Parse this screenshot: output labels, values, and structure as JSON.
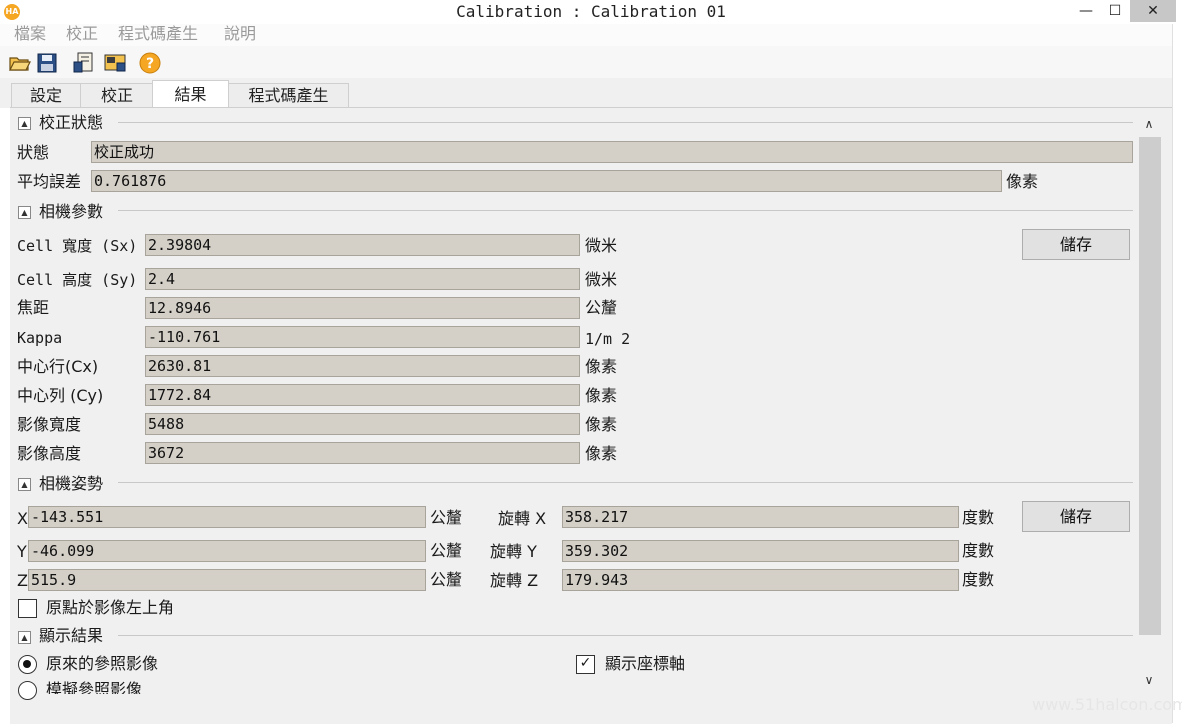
{
  "window": {
    "title": "Calibration : Calibration 01",
    "icon_text": "HA",
    "minimize": "—",
    "maximize": "☐",
    "close": "✕"
  },
  "menu": [
    "檔案",
    "校正",
    "程式碼產生",
    "說明"
  ],
  "tabs": [
    "設定",
    "校正",
    "結果",
    "程式碼產生"
  ],
  "status_section": {
    "title": "校正狀態",
    "status_label": "狀態",
    "status_value": "校正成功",
    "error_label": "平均誤差",
    "error_value": "0.761876",
    "error_unit": "像素"
  },
  "camera_params": {
    "title": "相機參數",
    "save": "儲存",
    "rows": [
      {
        "label": "Cell 寬度 (Sx)",
        "value": "2.39804",
        "unit": "微米"
      },
      {
        "label": "Cell 高度 (Sy)",
        "value": "2.4",
        "unit": "微米"
      },
      {
        "label": "焦距",
        "value": "12.8946",
        "unit": "公釐"
      },
      {
        "label": "Kappa",
        "value": "-110.761",
        "unit": "1/m 2"
      },
      {
        "label": "中心行(Cx)",
        "value": "2630.81",
        "unit": "像素"
      },
      {
        "label": "中心列 (Cy)",
        "value": "1772.84",
        "unit": "像素"
      },
      {
        "label": "影像寬度",
        "value": "5488",
        "unit": "像素"
      },
      {
        "label": "影像高度",
        "value": "3672",
        "unit": "像素"
      }
    ]
  },
  "camera_pose": {
    "title": "相機姿勢",
    "save": "儲存",
    "rows": [
      {
        "label": "X",
        "value": "-143.551",
        "unit": "公釐",
        "rot_label": "旋轉 X",
        "rot_value": "358.217",
        "rot_unit": "度數"
      },
      {
        "label": "Y",
        "value": "-46.099",
        "unit": "公釐",
        "rot_label": "旋轉 Y",
        "rot_value": "359.302",
        "rot_unit": "度數"
      },
      {
        "label": "Z",
        "value": "515.9",
        "unit": "公釐",
        "rot_label": "旋轉 Z",
        "rot_value": "179.943",
        "rot_unit": "度數"
      }
    ],
    "origin_checkbox": "原點於影像左上角",
    "origin_checked": false
  },
  "display": {
    "title": "顯示結果",
    "radio_original": "原來的參照影像",
    "radio_simulated": "模擬參照影像",
    "show_axes": "顯示座標軸",
    "show_axes_checked": true
  },
  "watermark": "www.51halcon.com"
}
